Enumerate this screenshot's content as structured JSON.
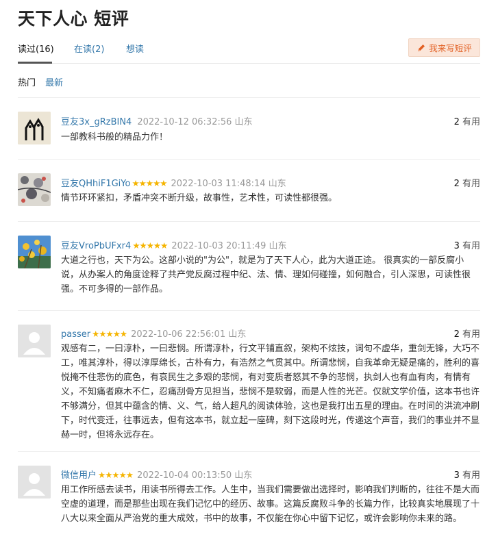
{
  "page_title": "天下人心 短评",
  "tabs": [
    {
      "label": "读过(16)"
    },
    {
      "label": "在读(2)"
    },
    {
      "label": "想读"
    }
  ],
  "write_button": "我来写短评",
  "sort": {
    "hot": "热门",
    "new": "最新"
  },
  "reviews": [
    {
      "user": "豆友3x_gRzBIN4",
      "stars": "",
      "time": "2022-10-12 06:32:56 山东",
      "useful_count": "2",
      "useful_label": "有用",
      "content": "一部教科书般的精品力作！",
      "avatar": "ink-glyph-avatar"
    },
    {
      "user": "豆友QHhiF1GiYo",
      "stars": "★★★★★",
      "time": "2022-10-03 11:48:14 山东",
      "useful_count": "2",
      "useful_label": "有用",
      "content": "情节环环紧扣，矛盾冲突不断升级，故事性，艺术性，可读性都很强。",
      "avatar": "blossom-painting-avatar"
    },
    {
      "user": "豆友VroPbUFxr4",
      "stars": "★★★★★",
      "time": "2022-10-03 20:11:49 山东",
      "useful_count": "3",
      "useful_label": "有用",
      "content": "大道之行也，天下为公。这部小说的\"为公\"，就是为了天下人心，此为大道正途。 很真实的一部反腐小说，从办案人的角度诠释了共产党反腐过程中纪、法、情、理如何碰撞，如何融合，引人深思，可读性很强。不可多得的一部作品。",
      "avatar": "flowers-sky-avatar"
    },
    {
      "user": "passer",
      "stars": "★★★★★",
      "time": "2022-10-06 22:56:01 山东",
      "useful_count": "2",
      "useful_label": "有用",
      "content": "观感有二，一曰淳朴，一曰悲悯。所谓淳朴，行文平铺直叙，架构不炫技，词句不虚华，重剑无锋，大巧不工，唯其淳朴，得以淳厚绵长，古朴有力，有浩然之气贯其中。所谓悲悯，自我革命无疑是痛的，胜利的喜悦掩不住悲伤的底色，有哀民生之多艰的悲悯，有对变质者怒其不争的悲悯，执剑人也有血有肉，有情有义，不知痛者麻木不仁，忍痛刮骨方见担当，悲悯不是软弱，而是人性的光芒。仅就文学价值，这本书也许不够满分，但其中蕴含的情、义、气，给人超凡的阅读体验，这也是我打出五星的理由。在时间的洪流冲刷下，时代变迁，往事远去，但有这本书，就立起一座碑，刻下这段时光，传递这个声音，我们的事业并不显赫一时，但将永远存在。",
      "avatar": "default-user-avatar"
    },
    {
      "user": "微信用户",
      "stars": "★★★★★",
      "time": "2022-10-04 00:13:50 山东",
      "useful_count": "3",
      "useful_label": "有用",
      "content": "用工作所感去读书，用读书所得去工作。人生中，当我们需要做出选择时，影响我们判断的，往往不是大而空虚的道理，而是那些出现在我们记忆中的经历、故事。这篇反腐败斗争的长篇力作，比较真实地展现了十八大以来全面从严治党的重大成效，书中的故事，不仅能在你心中留下记忆，或许会影响你未来的路。",
      "avatar": "default-user-avatar"
    }
  ],
  "colors": {
    "link": "#3377aa",
    "star": "#f5b400",
    "button_text": "#e25f22",
    "button_bg": "#fbe6da"
  }
}
